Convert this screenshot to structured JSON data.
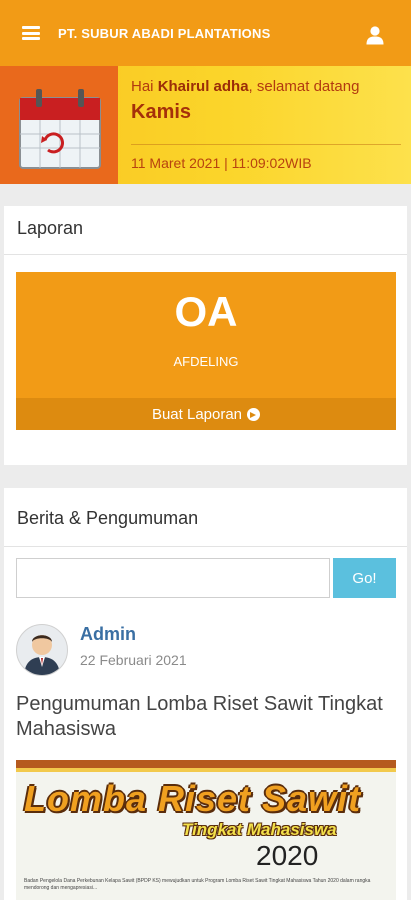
{
  "header": {
    "company": "PT. SUBUR ABADI PLANTATIONS",
    "brand_color": "#f29b16"
  },
  "banner": {
    "greeting_prefix": "Hai ",
    "user_name": "Khairul adha",
    "greeting_suffix": ", selamat datang",
    "day": "Kamis",
    "datetime": "11 Maret 2021 | 11:09:02WIB"
  },
  "laporan": {
    "title": "Laporan",
    "tile_code": "OA",
    "tile_label": "AFDELING",
    "action_label": "Buat Laporan"
  },
  "berita": {
    "title": "Berita & Pengumuman",
    "search_placeholder": "",
    "go_label": "Go!",
    "post": {
      "author": "Admin",
      "date": "22 Februari 2021",
      "title": "Pengumuman Lomba Riset Sawit Tingkat Mahasiswa",
      "image": {
        "title": "Lomba Riset Sawit",
        "subtitle": "Tingkat Mahasiswa",
        "year": "2020",
        "caption": "Badan Pengelola Dana Perkebunan Kelapa Sawit (BPDP KS) mewujudkan untuk Program Lomba Riset Sawit Tingkat Mahasiswa Tahun 2020 dalam rangka mendorong dan mengapresiasi..."
      }
    }
  }
}
